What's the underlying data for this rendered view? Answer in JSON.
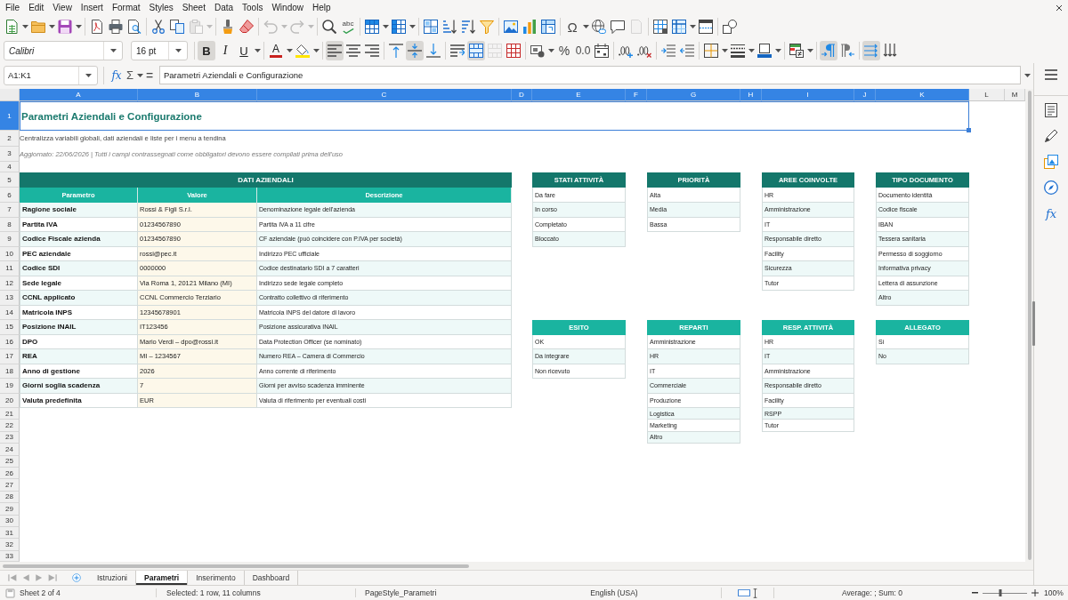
{
  "menu_bar": [
    "File",
    "Edit",
    "View",
    "Insert",
    "Format",
    "Styles",
    "Sheet",
    "Data",
    "Tools",
    "Window",
    "Help"
  ],
  "standard_toolbar": {
    "paste_disabled": true,
    "undo_disabled": true,
    "redo_disabled": true,
    "spelling_glyph": "abc",
    "special_character_glyph": "Ω",
    "headers_footers_disabled": true
  },
  "formatting_toolbar": {
    "font_name": "Calibri",
    "font_size": "16 pt",
    "bold": {
      "glyph": "B",
      "on": true
    },
    "italic": {
      "glyph": "I",
      "on": false
    },
    "underline": {
      "glyph": "U",
      "on": false
    },
    "font_color_glyph": "A",
    "align_left": true,
    "align_center": false,
    "align_right": false,
    "align_top": false,
    "align_middle": true,
    "align_bottom": false,
    "wrap_text": false,
    "merge_and_center": true,
    "merge_cells_disabled": true,
    "percent_glyph": "%",
    "number_glyph": "0.0",
    "left_to_right": true,
    "right_to_left": false,
    "text_horizontal": true,
    "text_vertical": false
  },
  "formula_bar": {
    "name_box": "A1:K1",
    "function_wizard_glyph": "fx",
    "sum_glyph": "Σ",
    "formula_glyph": "=",
    "content": "Parametri Aziendali e Configurazione"
  },
  "sheet": {
    "columns": [
      {
        "label": "A",
        "selected": true
      },
      {
        "label": "B",
        "selected": true
      },
      {
        "label": "C",
        "selected": true
      },
      {
        "label": "D",
        "selected": true
      },
      {
        "label": "E",
        "selected": true
      },
      {
        "label": "F",
        "selected": true
      },
      {
        "label": "G",
        "selected": true
      },
      {
        "label": "H",
        "selected": true
      },
      {
        "label": "I",
        "selected": true
      },
      {
        "label": "J",
        "selected": true
      },
      {
        "label": "K",
        "selected": true
      },
      {
        "label": "L",
        "selected": false
      },
      {
        "label": "M",
        "selected": false
      }
    ],
    "rows": [
      {
        "label": "1",
        "selected": true
      },
      {
        "label": "2",
        "selected": false
      },
      {
        "label": "3",
        "selected": false
      },
      {
        "label": "4",
        "selected": false
      },
      {
        "label": "5",
        "selected": false
      },
      {
        "label": "6",
        "selected": false
      },
      {
        "label": "7",
        "selected": false
      },
      {
        "label": "8",
        "selected": false
      },
      {
        "label": "9",
        "selected": false
      },
      {
        "label": "10",
        "selected": false
      },
      {
        "label": "11",
        "selected": false
      },
      {
        "label": "12",
        "selected": false
      },
      {
        "label": "13",
        "selected": false
      },
      {
        "label": "14",
        "selected": false
      },
      {
        "label": "15",
        "selected": false
      },
      {
        "label": "16",
        "selected": false
      },
      {
        "label": "17",
        "selected": false
      },
      {
        "label": "18",
        "selected": false
      },
      {
        "label": "19",
        "selected": false
      },
      {
        "label": "20",
        "selected": false
      },
      {
        "label": "21",
        "selected": false
      },
      {
        "label": "22",
        "selected": false
      },
      {
        "label": "23",
        "selected": false
      },
      {
        "label": "24",
        "selected": false
      },
      {
        "label": "25",
        "selected": false
      },
      {
        "label": "26",
        "selected": false
      },
      {
        "label": "27",
        "selected": false
      },
      {
        "label": "28",
        "selected": false
      },
      {
        "label": "29",
        "selected": false
      },
      {
        "label": "30",
        "selected": false
      },
      {
        "label": "31",
        "selected": false
      },
      {
        "label": "32",
        "selected": false
      },
      {
        "label": "33",
        "selected": false
      }
    ],
    "title": "Parametri Aziendali e Configurazione",
    "subtitle": "Centralizza variabili globali, dati aziendali e liste per i menu a tendina",
    "note": "Aggiornato: 22/06/2026 | Tutti i campi contrassegnati come obbligatori devono essere compilati prima dell'uso",
    "company_table": {
      "title": "DATI AZIENDALI",
      "columns": [
        "Parametro",
        "Valore",
        "Descrizione"
      ],
      "rows": [
        {
          "parameter": "Ragione sociale",
          "value": "Rossi & Figli S.r.l.",
          "description": "Denominazione legale dell'azienda"
        },
        {
          "parameter": "Partita IVA",
          "value": "01234567890",
          "description": "Partita IVA a 11 cifre"
        },
        {
          "parameter": "Codice Fiscale azienda",
          "value": "01234567890",
          "description": "CF aziendale (può coincidere con P.IVA per società)"
        },
        {
          "parameter": "PEC aziendale",
          "value": "rossi@pec.it",
          "description": "Indirizzo PEC ufficiale"
        },
        {
          "parameter": "Codice SDI",
          "value": "0000000",
          "description": "Codice destinatario SDI a 7 caratteri"
        },
        {
          "parameter": "Sede legale",
          "value": "Via Roma 1, 20121 Milano (MI)",
          "description": "Indirizzo sede legale completo"
        },
        {
          "parameter": "CCNL applicato",
          "value": "CCNL Commercio Terziario",
          "description": "Contratto collettivo di riferimento"
        },
        {
          "parameter": "Matricola INPS",
          "value": "12345678901",
          "description": "Matricola INPS del datore di lavoro"
        },
        {
          "parameter": "Posizione INAIL",
          "value": "IT123456",
          "description": "Posizione assicurativa INAIL"
        },
        {
          "parameter": "DPO",
          "value": "Mario Verdi – dpo@rossi.it",
          "description": "Data Protection Officer (se nominato)"
        },
        {
          "parameter": "REA",
          "value": "MI – 1234567",
          "description": "Numero REA – Camera di Commercio"
        },
        {
          "parameter": "Anno di gestione",
          "value": "2026",
          "description": "Anno corrente di riferimento"
        },
        {
          "parameter": "Giorni soglia scadenza",
          "value": "7",
          "description": "Giorni per avviso scadenza imminente"
        },
        {
          "parameter": "Valuta predefinita",
          "value": "EUR",
          "description": "Valuta di riferimento per eventuali costi"
        }
      ]
    },
    "lists": [
      {
        "title": "STATI ATTIVITÀ",
        "color": "#14776b",
        "items": [
          "Da fare",
          "In corso",
          "Completato",
          "Bloccato"
        ]
      },
      {
        "title": "PRIORITÀ",
        "color": "#14776b",
        "items": [
          "Alta",
          "Media",
          "Bassa"
        ]
      },
      {
        "title": "AREE COINVOLTE",
        "color": "#14776b",
        "items": [
          "HR",
          "Amministrazione",
          "IT",
          "Responsabile diretto",
          "Facility",
          "Sicurezza",
          "Tutor"
        ]
      },
      {
        "title": "TIPO DOCUMENTO",
        "color": "#14776b",
        "items": [
          "Documento identità",
          "Codice fiscale",
          "IBAN",
          "Tessera sanitaria",
          "Permesso di soggiorno",
          "Informativa privacy",
          "Lettera di assunzione",
          "Altro"
        ]
      },
      {
        "title": "ESITO",
        "color": "#1ab4a0",
        "items": [
          "OK",
          "Da integrare",
          "Non ricevuto"
        ]
      },
      {
        "title": "REPARTI",
        "color": "#1ab4a0",
        "items": [
          "Amministrazione",
          "HR",
          "IT",
          "Commerciale",
          "Produzione",
          "Logistica",
          "Marketing",
          "Altro"
        ]
      },
      {
        "title": "RESP. ATTIVITÀ",
        "color": "#1ab4a0",
        "items": [
          "HR",
          "IT",
          "Amministrazione",
          "Responsabile diretto",
          "Facility",
          "RSPP",
          "Tutor"
        ]
      },
      {
        "title": "ALLEGATO",
        "color": "#1ab4a0",
        "items": [
          "Sì",
          "No"
        ]
      }
    ]
  },
  "sheet_tabs": [
    {
      "label": "Istruzioni",
      "selected": false
    },
    {
      "label": "Parametri",
      "selected": true
    },
    {
      "label": "Inserimento",
      "selected": false
    },
    {
      "label": "Dashboard",
      "selected": false
    }
  ],
  "sidebar": {
    "functions_glyph": "fx"
  },
  "status_bar": {
    "sheet": "Sheet 2 of 4",
    "selection": "Selected: 1 row, 11 columns",
    "page_style": "PageStyle_Parametri",
    "language": "English (USA)",
    "sum": "Average: ; Sum: 0",
    "zoom_slider": {
      "level": 0.4
    },
    "zoom": "100%"
  }
}
